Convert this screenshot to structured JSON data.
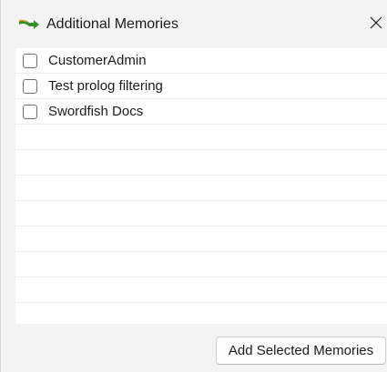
{
  "window": {
    "title": "Additional Memories",
    "icon": "green-arrow-icon",
    "close_icon": "close-icon"
  },
  "memories": {
    "items": [
      {
        "label": "CustomerAdmin",
        "checked": false
      },
      {
        "label": "Test prolog filtering",
        "checked": false
      },
      {
        "label": "Swordfish Docs",
        "checked": false
      }
    ]
  },
  "actions": {
    "add_label": "Add Selected Memories"
  },
  "colors": {
    "background": "#f3f3f3",
    "list_background": "#ffffff",
    "icon_green": "#3a8a2e",
    "icon_accent": "#e0a020"
  }
}
